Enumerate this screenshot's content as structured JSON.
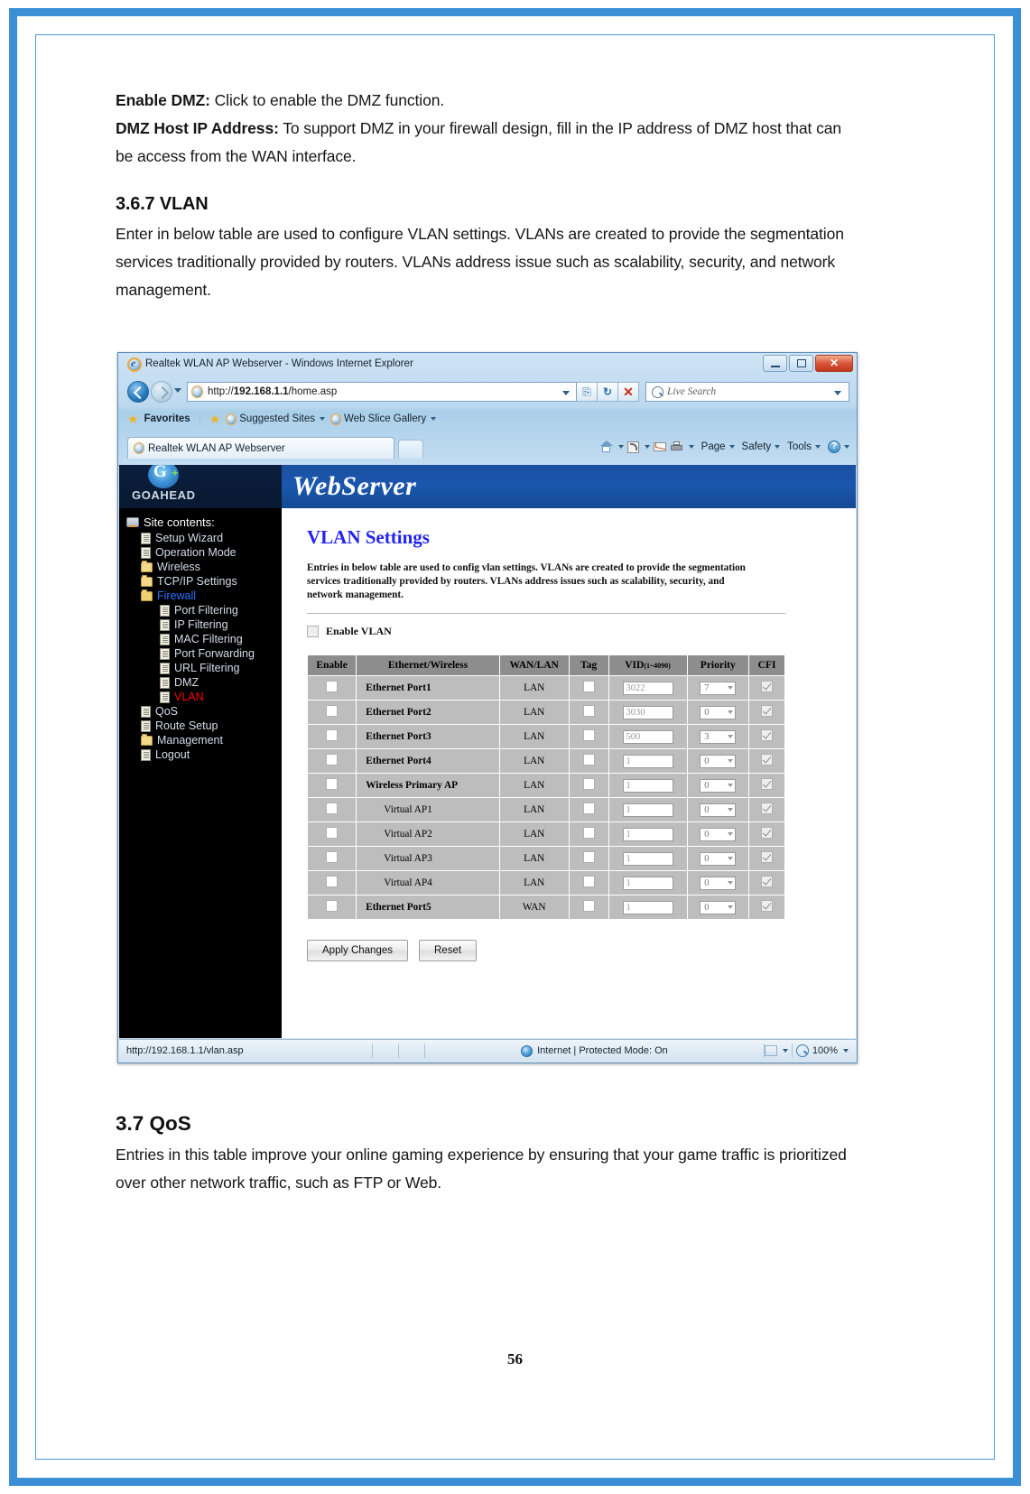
{
  "document": {
    "paragraphs": [
      {
        "bold": "Enable DMZ:",
        "text": " Click to enable the DMZ function."
      },
      {
        "bold": "DMZ Host IP Address:",
        "text": " To support DMZ in your firewall design, fill in the IP address of DMZ host that can be access from the WAN interface."
      }
    ],
    "section_vlan": {
      "heading": "3.6.7 VLAN",
      "body": "Enter in below table are used to configure VLAN settings. VLANs are created to provide the segmentation services traditionally provided by routers. VLANs address issue such as scalability, security, and network management."
    },
    "section_qos": {
      "heading": "3.7  QoS",
      "body": "Entries in this table improve your online gaming experience by ensuring that your game traffic is prioritized over other network traffic, such as FTP or Web."
    },
    "page_number": "56"
  },
  "browser": {
    "title": "Realtek WLAN AP Webserver - Windows Internet Explorer",
    "window_buttons": {
      "minimize": "—",
      "maximize": "□",
      "close": "✕"
    },
    "address": {
      "protocol": "http://",
      "host": "192.168.1.1",
      "path": "/home.asp"
    },
    "nav_buttons": {
      "compat": "⎘",
      "refresh": "↻",
      "stop": "✕"
    },
    "search": {
      "placeholder": "Live Search"
    },
    "favorites_bar": {
      "favorites_label": "Favorites",
      "items": [
        "Suggested Sites",
        "Web Slice Gallery"
      ]
    },
    "tab": {
      "title": "Realtek WLAN AP Webserver"
    },
    "command_bar": {
      "icons": [
        "home-icon",
        "rss-icon",
        "mail-icon",
        "print-icon"
      ],
      "menus": [
        "Page",
        "Safety",
        "Tools"
      ],
      "help": "?"
    },
    "status": {
      "url": "http://192.168.1.1/vlan.asp",
      "zone": "Internet | Protected Mode: On",
      "zoom": "100%"
    }
  },
  "router": {
    "banner_title": "WebServer",
    "logo_text": "GOAHEAD",
    "sidebar": {
      "root": "Site contents:",
      "items": [
        {
          "label": "Setup Wizard",
          "icon": "doc-icon",
          "level": 1,
          "state": "normal"
        },
        {
          "label": "Operation Mode",
          "icon": "doc-icon",
          "level": 1,
          "state": "normal"
        },
        {
          "label": "Wireless",
          "icon": "folder-icon",
          "level": 1,
          "state": "normal"
        },
        {
          "label": "TCP/IP Settings",
          "icon": "folder-icon",
          "level": 1,
          "state": "normal"
        },
        {
          "label": "Firewall",
          "icon": "folder-open-icon",
          "level": 1,
          "state": "expanded"
        },
        {
          "label": "Port Filtering",
          "icon": "doc-icon",
          "level": 2,
          "state": "normal"
        },
        {
          "label": "IP Filtering",
          "icon": "doc-icon",
          "level": 2,
          "state": "normal"
        },
        {
          "label": "MAC Filtering",
          "icon": "doc-icon",
          "level": 2,
          "state": "normal"
        },
        {
          "label": "Port Forwarding",
          "icon": "doc-icon",
          "level": 2,
          "state": "normal"
        },
        {
          "label": "URL Filtering",
          "icon": "doc-icon",
          "level": 2,
          "state": "normal"
        },
        {
          "label": "DMZ",
          "icon": "doc-icon",
          "level": 2,
          "state": "normal"
        },
        {
          "label": "VLAN",
          "icon": "doc-icon",
          "level": 2,
          "state": "selected"
        },
        {
          "label": "QoS",
          "icon": "doc-icon",
          "level": 1,
          "state": "normal"
        },
        {
          "label": "Route Setup",
          "icon": "doc-icon",
          "level": 1,
          "state": "normal"
        },
        {
          "label": "Management",
          "icon": "folder-icon",
          "level": 1,
          "state": "normal"
        },
        {
          "label": "Logout",
          "icon": "doc-icon",
          "level": 1,
          "state": "normal"
        }
      ]
    },
    "page": {
      "title": "VLAN Settings",
      "description": "Entries in below table are used to config vlan settings. VLANs are created to provide the segmentation services traditionally provided by routers. VLANs address issues such as scalability, security, and network management.",
      "enable_vlan_label": "Enable VLAN",
      "enable_vlan_checked": false,
      "table": {
        "headers": [
          "Enable",
          "Ethernet/Wireless",
          "WAN/LAN",
          "Tag",
          "VID",
          "Priority",
          "CFI"
        ],
        "vid_range": "(1~4090)",
        "rows": [
          {
            "enable": false,
            "name": "Ethernet Port1",
            "indent": false,
            "wanlan": "LAN",
            "tag": false,
            "vid": "3022",
            "priority": "7",
            "cfi": true
          },
          {
            "enable": false,
            "name": "Ethernet Port2",
            "indent": false,
            "wanlan": "LAN",
            "tag": false,
            "vid": "3030",
            "priority": "0",
            "cfi": true
          },
          {
            "enable": false,
            "name": "Ethernet Port3",
            "indent": false,
            "wanlan": "LAN",
            "tag": false,
            "vid": "500",
            "priority": "3",
            "cfi": true
          },
          {
            "enable": false,
            "name": "Ethernet Port4",
            "indent": false,
            "wanlan": "LAN",
            "tag": false,
            "vid": "1",
            "priority": "0",
            "cfi": true
          },
          {
            "enable": false,
            "name": "Wireless Primary AP",
            "indent": false,
            "wanlan": "LAN",
            "tag": false,
            "vid": "1",
            "priority": "0",
            "cfi": true
          },
          {
            "enable": false,
            "name": "Virtual AP1",
            "indent": true,
            "wanlan": "LAN",
            "tag": false,
            "vid": "1",
            "priority": "0",
            "cfi": true
          },
          {
            "enable": false,
            "name": "Virtual AP2",
            "indent": true,
            "wanlan": "LAN",
            "tag": false,
            "vid": "1",
            "priority": "0",
            "cfi": true
          },
          {
            "enable": false,
            "name": "Virtual AP3",
            "indent": true,
            "wanlan": "LAN",
            "tag": false,
            "vid": "1",
            "priority": "0",
            "cfi": true
          },
          {
            "enable": false,
            "name": "Virtual AP4",
            "indent": true,
            "wanlan": "LAN",
            "tag": false,
            "vid": "1",
            "priority": "0",
            "cfi": true
          },
          {
            "enable": false,
            "name": "Ethernet Port5",
            "indent": false,
            "wanlan": "WAN",
            "tag": false,
            "vid": "1",
            "priority": "0",
            "cfi": true
          }
        ]
      },
      "buttons": {
        "apply": "Apply Changes",
        "reset": "Reset"
      }
    }
  },
  "colors": {
    "page_border": "#3b8fd4",
    "vlan_title": "#2424ee",
    "selected_nav": "#ff0000",
    "expanded_nav": "#2b6fff",
    "banner": "#1b57ae"
  }
}
